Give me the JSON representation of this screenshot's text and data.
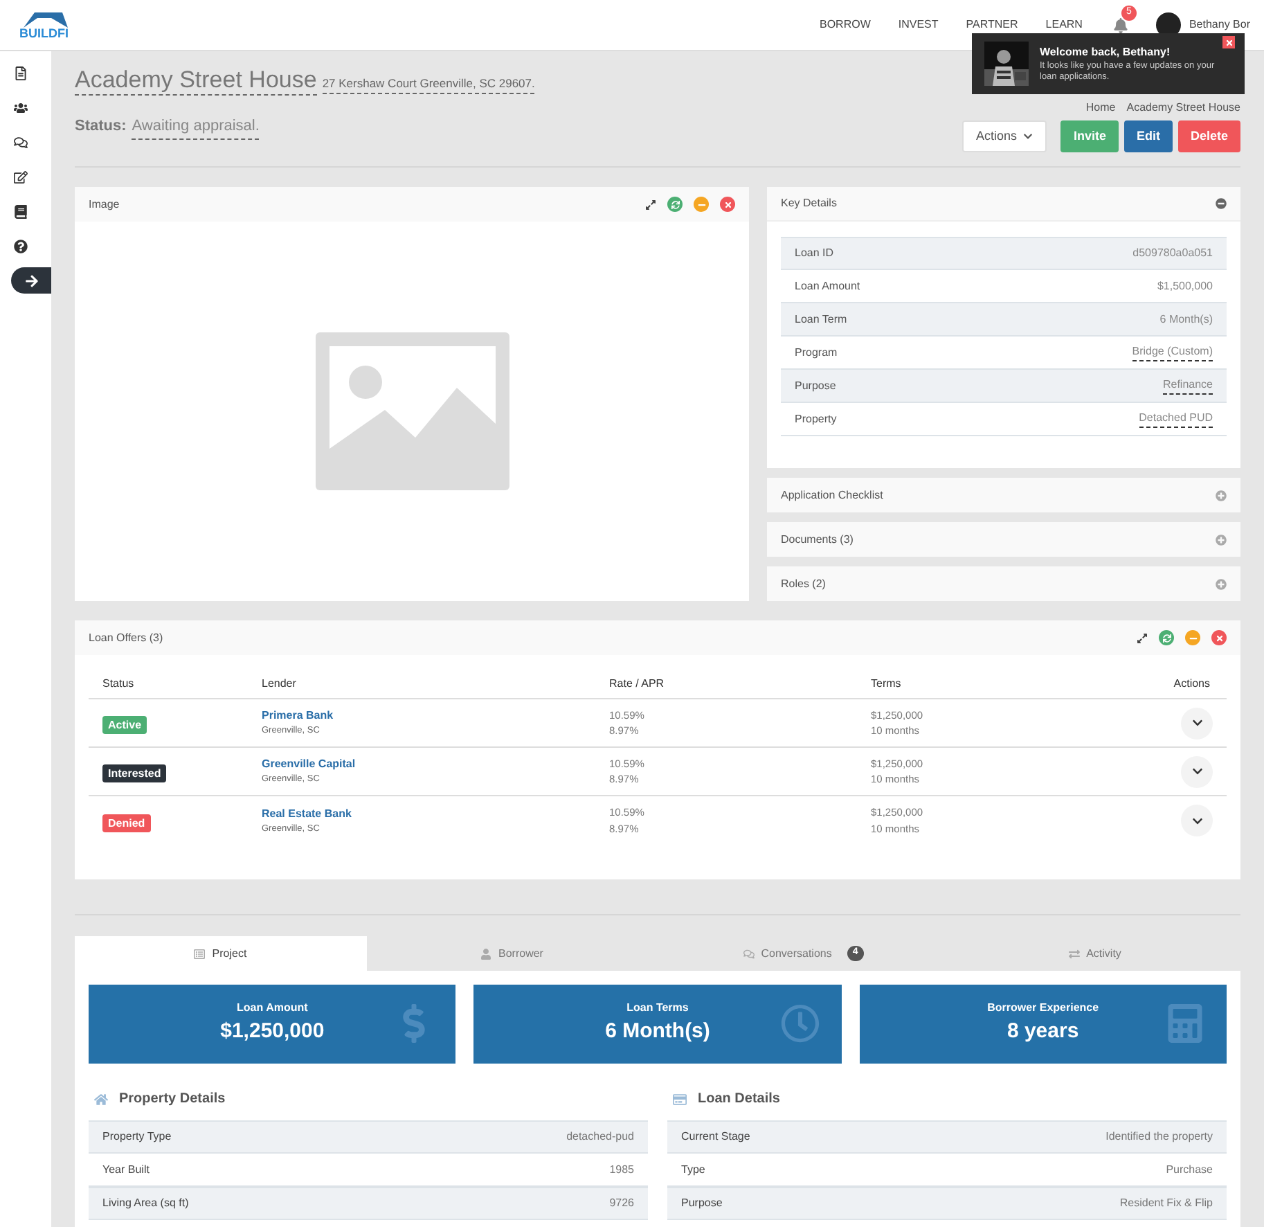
{
  "brand": "BUILDFI",
  "nav": {
    "links": [
      "BORROW",
      "INVEST",
      "PARTNER",
      "LEARN"
    ],
    "notifications": "5",
    "user": "Bethany Bor"
  },
  "toast": {
    "title": "Welcome back, Bethany!",
    "message": "It looks like you have a few updates on your loan applications."
  },
  "sidebar": [
    {
      "selected": false
    },
    {
      "selected": false
    },
    {
      "selected": false
    },
    {
      "selected": false
    },
    {
      "selected": false
    },
    {
      "selected": false
    },
    {
      "selected": true
    }
  ],
  "page": {
    "title": "Academy Street House",
    "address": "27 Kershaw Court Greenville, SC 29607.",
    "status_label": "Status:",
    "status": "Awaiting appraisal.",
    "breadcrumb": [
      "Home",
      "Academy Street House"
    ],
    "buttons": [
      {
        "label": "Actions",
        "kind": "dropdown"
      },
      {
        "label": "Invite",
        "kind": "success"
      },
      {
        "label": "Edit",
        "kind": "primary"
      },
      {
        "label": "Delete",
        "kind": "danger"
      }
    ]
  },
  "image_panel": {
    "title": "Image"
  },
  "key_details": {
    "title": "Key Details",
    "expanded": true,
    "rows": [
      {
        "label": "Loan ID",
        "value": "d509780a0a051",
        "dashed": false
      },
      {
        "label": "Loan Amount",
        "value": "$1,500,000",
        "dashed": false
      },
      {
        "label": "Loan Term",
        "value": "6 Month(s)",
        "dashed": false
      },
      {
        "label": "Program",
        "value": "Bridge (Custom)",
        "dashed": true
      },
      {
        "label": "Purpose",
        "value": "Refinance",
        "dashed": true
      },
      {
        "label": "Property",
        "value": "Detached PUD",
        "dashed": true
      }
    ]
  },
  "collapsibles": [
    {
      "title": "Application Checklist",
      "expanded": false
    },
    {
      "title": "Documents (3)",
      "expanded": false
    },
    {
      "title": "Roles (2)",
      "expanded": false
    }
  ],
  "loan_offers": {
    "title": "Loan Offers (3)",
    "columns": [
      "Status",
      "Lender",
      "Rate / APR",
      "Terms",
      "Actions"
    ],
    "rows": [
      {
        "status": "Active",
        "color": "#4caf73",
        "lender": "Primera Bank",
        "location": "Greenville, SC",
        "rate": "10.59%",
        "apr": "8.97%",
        "amount": "$1,250,000",
        "term": "10 months"
      },
      {
        "status": "Interested",
        "color": "#2c333b",
        "lender": "Greenville Capital",
        "location": "Greenville, SC",
        "rate": "10.59%",
        "apr": "8.97%",
        "amount": "$1,250,000",
        "term": "10 months"
      },
      {
        "status": "Denied",
        "color": "#f0565a",
        "lender": "Real Estate Bank",
        "location": "Greenville, SC",
        "rate": "10.59%",
        "apr": "8.97%",
        "amount": "$1,250,000",
        "term": "10 months"
      }
    ]
  },
  "tabs": [
    {
      "label": "Project",
      "selected": true
    },
    {
      "label": "Borrower",
      "selected": false
    },
    {
      "label": "Conversations",
      "badge": "4",
      "selected": false
    },
    {
      "label": "Activity",
      "selected": false
    }
  ],
  "stats": [
    {
      "label": "Loan Amount",
      "value": "$1,250,000"
    },
    {
      "label": "Loan Terms",
      "value": "6 Month(s)"
    },
    {
      "label": "Borrower Experience",
      "value": "8 years"
    }
  ],
  "property_details": {
    "title": "Property Details",
    "rows": [
      {
        "label": "Property Type",
        "value": "detached-pud"
      },
      {
        "label": "Year Built",
        "value": "1985"
      },
      {
        "label": "Living Area (sq ft)",
        "value": "9726"
      }
    ]
  },
  "loan_details": {
    "title": "Loan Details",
    "rows": [
      {
        "label": "Current Stage",
        "value": "Identified the property"
      },
      {
        "label": "Type",
        "value": "Purchase"
      },
      {
        "label": "Purpose",
        "value": "Resident Fix & Flip"
      }
    ]
  }
}
